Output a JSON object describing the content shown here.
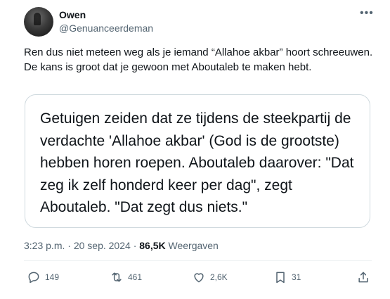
{
  "author": {
    "name": "Owen",
    "handle": "@Genuanceerdeman"
  },
  "more_icon": "more-horizontal-icon",
  "tweet_text": "Ren dus niet meteen weg als je iemand “Allahoe akbar” hoort schreeuwen. De kans is groot dat je gewoon met Aboutaleb te maken hebt.",
  "quote": {
    "text": "Getuigen zeiden dat ze tijdens de steekpartij de verdachte 'Allahoe akbar' (God is de grootste) hebben horen roepen. Aboutaleb daarover: \"Dat zeg ik zelf honderd keer per dag\", zegt Aboutaleb. \"Dat zegt dus niets.\""
  },
  "meta": {
    "time": "3:23 p.m.",
    "separator": "·",
    "date": "20 sep. 2024",
    "views_count": "86,5K",
    "views_label": "Weergaven"
  },
  "actions": {
    "replies": "149",
    "reposts": "461",
    "likes": "2,6K",
    "bookmarks": "31"
  },
  "icons": [
    "reply-icon",
    "repost-icon",
    "like-icon",
    "bookmark-icon",
    "share-icon"
  ]
}
